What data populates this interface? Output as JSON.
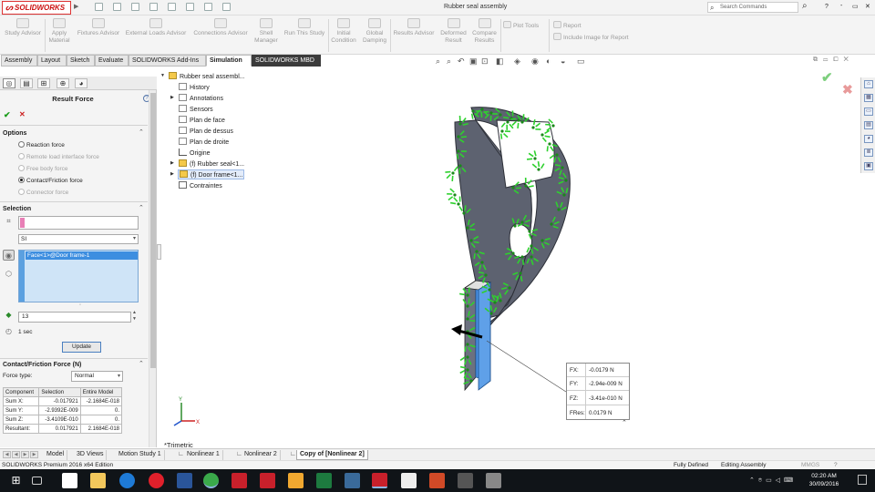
{
  "app": {
    "logo_text": "SOLIDWORKS",
    "document_title": "Rubber seal assembly",
    "search_placeholder": "Search Commands",
    "window_controls": [
      "?",
      "-",
      "▭",
      "✕"
    ]
  },
  "command_manager": {
    "items": [
      {
        "label": "Study Advisor"
      },
      {
        "label": "Apply\nMaterial"
      },
      {
        "label": "Fixtures Advisor"
      },
      {
        "label": "External Loads Advisor"
      },
      {
        "label": "Connections Advisor"
      },
      {
        "label": "Shell\nManager"
      },
      {
        "label": "Run This Study"
      },
      {
        "label": "Initial\nCondition"
      },
      {
        "label": "Global\nDamping"
      },
      {
        "label": "Results Advisor"
      },
      {
        "label": "Deformed\nResult"
      },
      {
        "label": "Compare\nResults"
      },
      {
        "label": "Plot Tools"
      },
      {
        "label": "Report"
      },
      {
        "label": "Include Image for Report"
      }
    ]
  },
  "tabs": [
    {
      "label": "Assembly"
    },
    {
      "label": "Layout"
    },
    {
      "label": "Sketch"
    },
    {
      "label": "Evaluate"
    },
    {
      "label": "SOLIDWORKS Add-Ins"
    },
    {
      "label": "Simulation",
      "active": true
    },
    {
      "label": "SOLIDWORKS MBD",
      "dark": true
    }
  ],
  "property_manager": {
    "title": "Result Force",
    "options_header": "Options",
    "options": [
      {
        "label": "Reaction force",
        "checked": false,
        "disabled": false
      },
      {
        "label": "Remote load interface force",
        "checked": false,
        "disabled": true
      },
      {
        "label": "Free body force",
        "checked": false,
        "disabled": true
      },
      {
        "label": "Contact/Friction force",
        "checked": true,
        "disabled": false
      },
      {
        "label": "Connector force",
        "checked": false,
        "disabled": true
      }
    ],
    "selection_header": "Selection",
    "units": "SI",
    "selected_face": "Face<1>@Door frame-1",
    "step_value": "13",
    "time_label": "1 sec",
    "update_label": "Update",
    "contact_header": "Contact/Friction Force (N)",
    "force_type_label": "Force type:",
    "force_type_value": "Normal",
    "table": {
      "headers": [
        "Component",
        "Selection",
        "Entire Model"
      ],
      "rows": [
        [
          "Sum X:",
          "-0.017921",
          "-2.1684E-018"
        ],
        [
          "Sum Y:",
          "-2.9392E-009",
          "0."
        ],
        [
          "Sum Z:",
          "-3.4109E-010",
          "0."
        ],
        [
          "Resultant:",
          "0.017921",
          "2.1684E-018"
        ]
      ]
    }
  },
  "feature_tree": [
    {
      "label": "Rubber seal assembl...",
      "level": 0,
      "expanded": true
    },
    {
      "label": "History",
      "level": 1
    },
    {
      "label": "Annotations",
      "level": 1,
      "arrow": true
    },
    {
      "label": "Sensors",
      "level": 1
    },
    {
      "label": "Plan de face",
      "level": 1
    },
    {
      "label": "Plan de dessus",
      "level": 1
    },
    {
      "label": "Plan de droite",
      "level": 1
    },
    {
      "label": "Origine",
      "level": 1
    },
    {
      "label": "(f) Rubber seal<1...",
      "level": 1,
      "arrow": true
    },
    {
      "label": "(f) Door frame<1...",
      "level": 1,
      "arrow": true,
      "selected": true
    },
    {
      "label": "Contraintes",
      "level": 1
    }
  ],
  "force_readout": {
    "rows": [
      {
        "key": "FX:",
        "value": "-0.0179 N"
      },
      {
        "key": "FY:",
        "value": "-2.94e-009 N"
      },
      {
        "key": "FZ:",
        "value": "-3.41e-010 N"
      },
      {
        "key": "FRes:",
        "value": "0.0179 N"
      }
    ]
  },
  "view_name": "*Trimetric",
  "triad": {
    "x": "X",
    "y": "Y"
  },
  "model_tabs": [
    {
      "label": "Model"
    },
    {
      "label": "3D Views"
    },
    {
      "label": "Motion Study 1"
    },
    {
      "label": "Nonlinear 1"
    },
    {
      "label": "Nonlinear 2"
    },
    {
      "label": "Copy of [Nonlinear 2]",
      "active": true
    }
  ],
  "status": {
    "edition": "SOLIDWORKS Premium 2016 x64 Edition",
    "state": "Fully Defined",
    "mode": "Editing Assembly",
    "units": "MMGS"
  },
  "taskbar": {
    "time": "02:20 AM",
    "date": "30/09/2016"
  },
  "colors": {
    "accent": "#3d8ee0",
    "model_gray": "#5d6270",
    "arrow_green": "#2ed12e",
    "face_blue": "#4a90e2"
  }
}
